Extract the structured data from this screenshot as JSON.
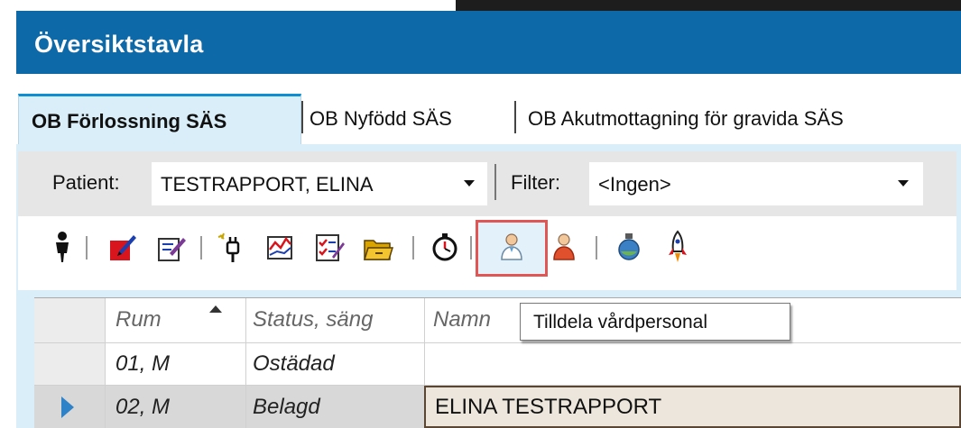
{
  "window": {
    "title": "Översiktstavla"
  },
  "tabs": [
    {
      "label": "OB Förlossning SÄS",
      "active": true
    },
    {
      "label": "OB Nyfödd SÄS",
      "active": false
    },
    {
      "label": "OB Akutmottagning för gravida SÄS",
      "active": false
    }
  ],
  "filterbar": {
    "patient_label": "Patient:",
    "patient_value": "TESTRAPPORT, ELINA",
    "filter_label": "Filter:",
    "filter_value": "<Ingen>"
  },
  "toolbar": {
    "icons": [
      "person-silhouette-icon",
      "red-edit-document-icon",
      "edit-document-icon",
      "plug-icon",
      "chart-icon",
      "checklist-icon",
      "open-folder-icon",
      "stopwatch-icon",
      "assign-staff-icon",
      "red-person-icon",
      "bottle-icon",
      "rocket-icon"
    ],
    "highlighted_button": "assign-staff-icon",
    "tooltip": "Tilldela vårdpersonal"
  },
  "grid": {
    "columns": [
      "Rum",
      "Status, säng",
      "Namn"
    ],
    "sort_column": "Rum",
    "rows": [
      {
        "rum": "01, M",
        "status": "Ostädad",
        "namn": ""
      },
      {
        "rum": "02, M",
        "status": "Belagd",
        "namn": "ELINA TESTRAPPORT",
        "selected": true
      }
    ]
  },
  "colors": {
    "titlebar": "#0e69a8",
    "tab_active": "#d9eef8",
    "highlight_border": "#e25555",
    "row_pointer": "#2e82c8"
  }
}
